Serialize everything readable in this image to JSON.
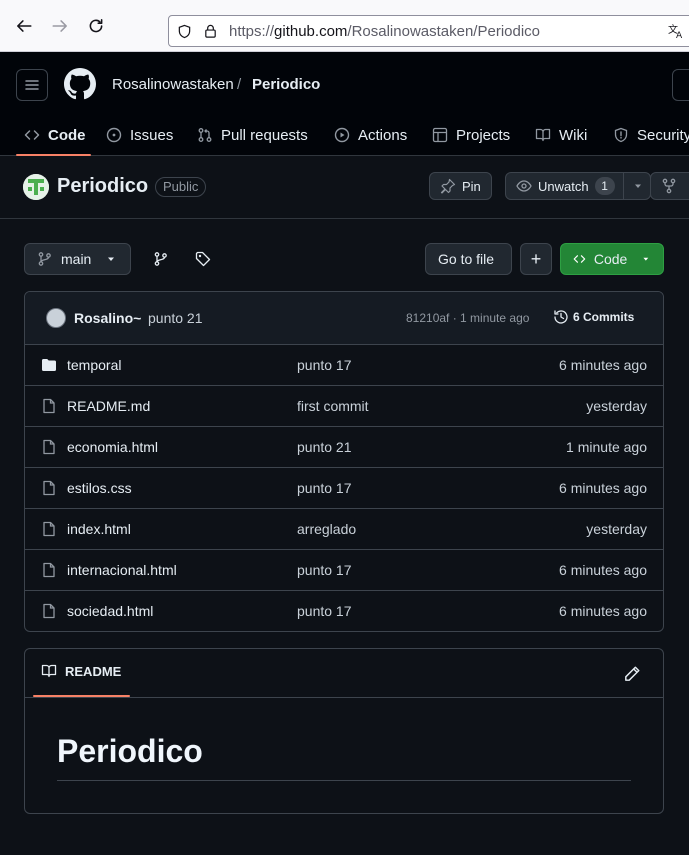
{
  "browser": {
    "url_prefix": "https://",
    "url_host": "github.com",
    "url_path": "/Rosalinowastaken/Periodico"
  },
  "header": {
    "owner": "Rosalinowastaken",
    "separator": "/",
    "repo": "Periodico"
  },
  "tabs": [
    {
      "label": "Code",
      "icon": "code-icon"
    },
    {
      "label": "Issues",
      "icon": "issue-icon"
    },
    {
      "label": "Pull requests",
      "icon": "pull-request-icon"
    },
    {
      "label": "Actions",
      "icon": "play-icon"
    },
    {
      "label": "Projects",
      "icon": "table-icon"
    },
    {
      "label": "Wiki",
      "icon": "book-icon"
    },
    {
      "label": "Security",
      "icon": "shield-icon"
    }
  ],
  "repo": {
    "name": "Periodico",
    "visibility": "Public",
    "pin_label": "Pin",
    "unwatch_label": "Unwatch",
    "watch_count": "1"
  },
  "file_nav": {
    "branch": "main",
    "go_to_file": "Go to file",
    "add": "+",
    "code_label": "Code"
  },
  "latest_commit": {
    "author": "Rosalino~",
    "message": "punto 21",
    "meta": "81210af · 1 minute ago",
    "commits_label": "6 Commits"
  },
  "files": [
    {
      "name": "temporal",
      "type": "folder",
      "commit": "punto 17",
      "date": "6 minutes ago"
    },
    {
      "name": "README.md",
      "type": "file",
      "commit": "first commit",
      "date": "yesterday"
    },
    {
      "name": "economia.html",
      "type": "file",
      "commit": "punto 21",
      "date": "1 minute ago"
    },
    {
      "name": "estilos.css",
      "type": "file",
      "commit": "punto 17",
      "date": "6 minutes ago"
    },
    {
      "name": "index.html",
      "type": "file",
      "commit": "arreglado",
      "date": "yesterday"
    },
    {
      "name": "internacional.html",
      "type": "file",
      "commit": "punto 17",
      "date": "6 minutes ago"
    },
    {
      "name": "sociedad.html",
      "type": "file",
      "commit": "punto 17",
      "date": "6 minutes ago"
    }
  ],
  "readme": {
    "tab_label": "README",
    "heading": "Periodico"
  },
  "colors": {
    "accent_underline": "#f78166",
    "code_button": "#238636",
    "background": "#0d1117"
  }
}
